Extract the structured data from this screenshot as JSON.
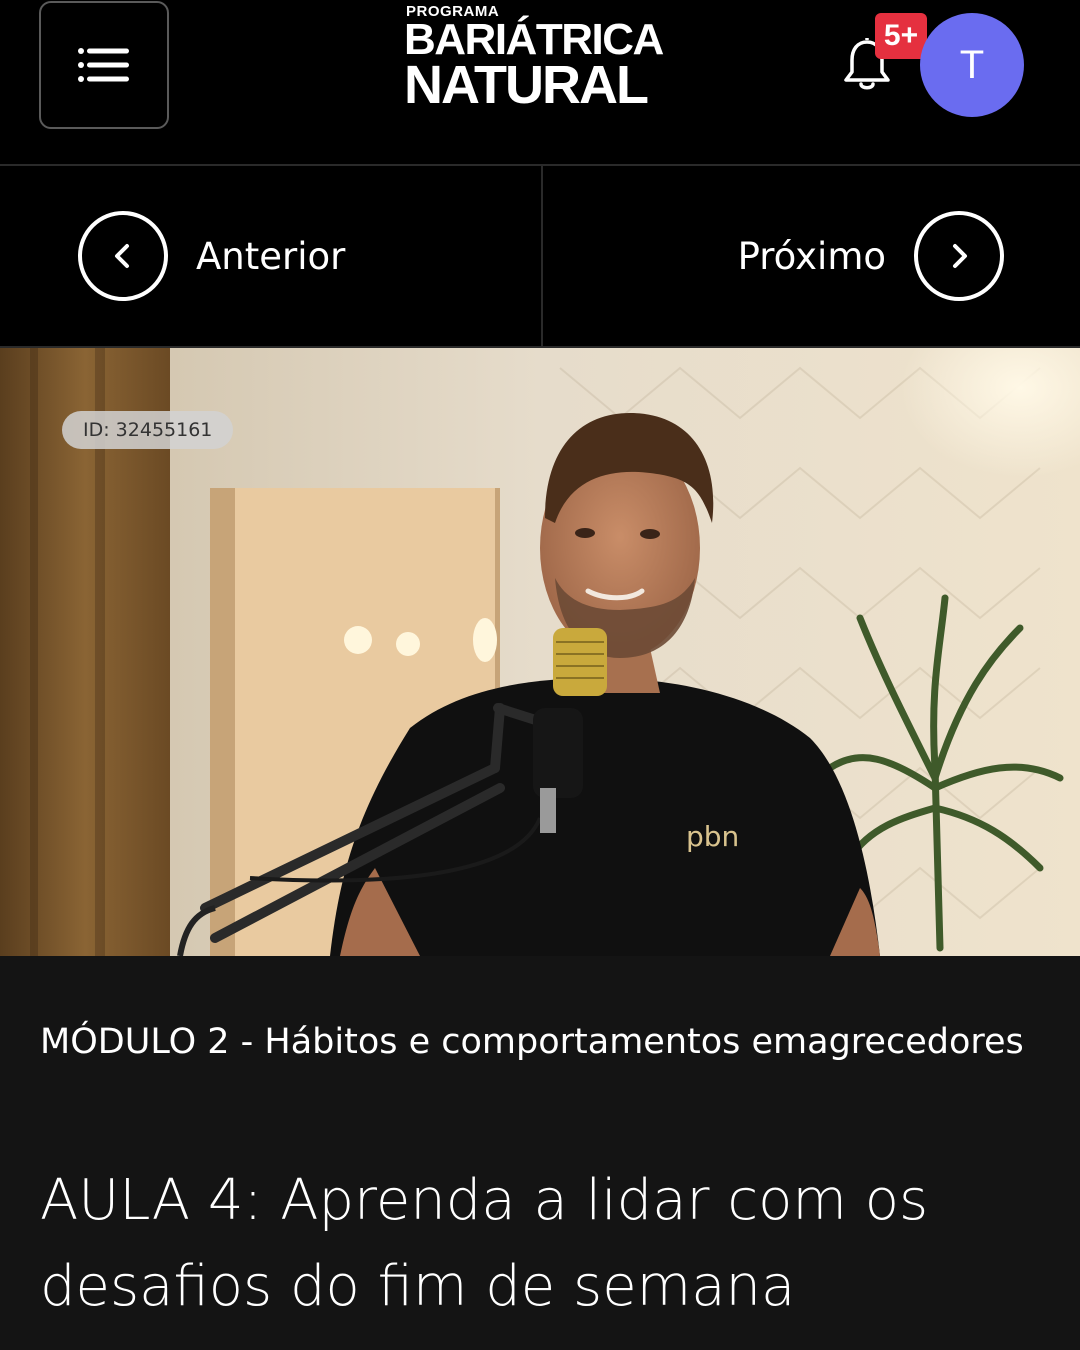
{
  "header": {
    "logo_small": "PROGRAMA",
    "logo_line1": "BARIÁTRICA",
    "logo_line2": "NATURAL",
    "notification_badge": "5+",
    "avatar_initial": "T",
    "icons": [
      "menu-icon",
      "bell-icon"
    ],
    "colors": {
      "badge": "#e5303f",
      "avatar": "#6a6cf0"
    }
  },
  "nav": {
    "prev_label": "Anterior",
    "next_label": "Próximo",
    "icons": [
      "chevron-left-icon",
      "chevron-right-icon"
    ]
  },
  "video": {
    "id_label": "ID: 32455161",
    "shirt_text": "pbn"
  },
  "lesson": {
    "module": "MÓDULO 2 - Hábitos e comportamentos emagrecedores",
    "title": "AULA 4: Aprenda a lidar com os desafios do fim de semana"
  }
}
